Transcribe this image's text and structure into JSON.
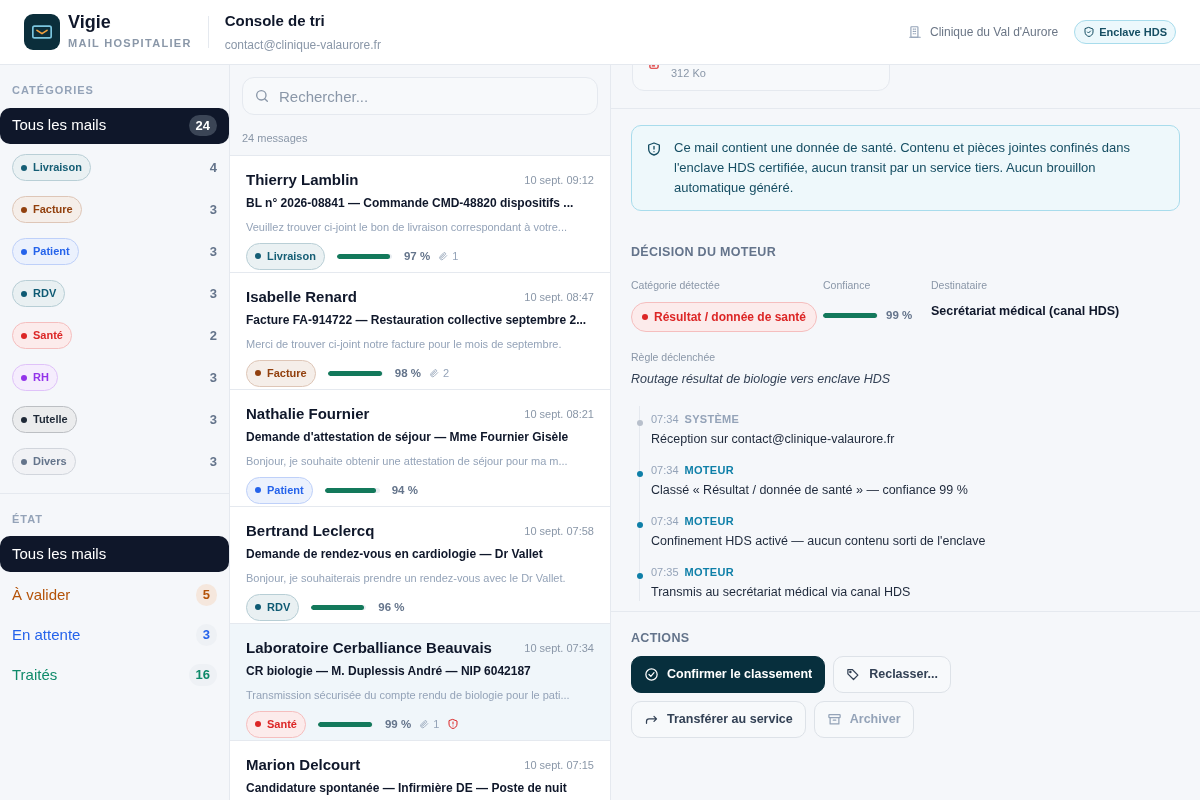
{
  "header": {
    "app_name": "Vigie",
    "app_subtitle": "MAIL HOSPITALIER",
    "title": "Console de tri",
    "account": "contact@clinique-valaurore.fr",
    "organization": "Clinique du Val d'Aurore",
    "badge": "Enclave HDS"
  },
  "sidebar": {
    "categories_heading": "CATÉGORIES",
    "categories": [
      {
        "kind": "all",
        "label": "Tous les mails",
        "count": "24",
        "selected": true
      },
      {
        "kind": "tag",
        "label": "Livraison",
        "count": "4",
        "color": "#155e75",
        "selected": false
      },
      {
        "kind": "tag",
        "label": "Facture",
        "count": "3",
        "color": "#92400e",
        "selected": false
      },
      {
        "kind": "tag",
        "label": "Patient",
        "count": "3",
        "color": "#2563eb",
        "selected": false
      },
      {
        "kind": "tag",
        "label": "RDV",
        "count": "3",
        "color": "#0e5a73",
        "selected": false
      },
      {
        "kind": "tag",
        "label": "Santé",
        "count": "2",
        "color": "#dc2626",
        "selected": false
      },
      {
        "kind": "tag",
        "label": "RH",
        "count": "3",
        "color": "#9333ea",
        "selected": false
      },
      {
        "kind": "tag",
        "label": "Tutelle",
        "count": "3",
        "color": "#1f2937",
        "selected": false
      },
      {
        "kind": "tag",
        "label": "Divers",
        "count": "3",
        "color": "#64748b",
        "selected": false
      }
    ],
    "state_heading": "ÉTAT",
    "states": [
      {
        "label": "Tous les mails",
        "selected": true
      },
      {
        "label": "À valider",
        "count": "5",
        "color": "#b45309",
        "selected": false
      },
      {
        "label": "En attente",
        "count": "3",
        "color": "#2563eb",
        "selected": false
      },
      {
        "label": "Traités",
        "count": "16",
        "color": "#0f8a6a",
        "selected": false
      }
    ]
  },
  "mail_list": {
    "search_placeholder": "Rechercher...",
    "count_label": "24 messages",
    "messages": [
      {
        "sender": "Thierry Lamblin",
        "date": "10 sept. 09:12",
        "subject": "BL n° 2026-08841 — Commande CMD-48820 dispositifs ...",
        "preview": "Veuillez trouver ci-joint le bon de livraison correspondant à votre...",
        "tag": {
          "label": "Livraison",
          "color": "#155e75"
        },
        "level": 0.97,
        "confidence": "97 %",
        "attachments": "1",
        "hds": false,
        "selected": false
      },
      {
        "sender": "Isabelle Renard",
        "date": "10 sept. 08:47",
        "subject": "Facture FA-914722 — Restauration collective septembre 2...",
        "preview": "Merci de trouver ci-joint notre facture pour le mois de septembre.",
        "tag": {
          "label": "Facture",
          "color": "#92400e"
        },
        "level": 0.98,
        "confidence": "98 %",
        "attachments": "2",
        "hds": false,
        "selected": false
      },
      {
        "sender": "Nathalie Fournier",
        "date": "10 sept. 08:21",
        "subject": "Demande d'attestation de séjour — Mme Fournier Gisèle",
        "preview": "Bonjour, je souhaite obtenir une attestation de séjour pour ma m...",
        "tag": {
          "label": "Patient",
          "color": "#2563eb"
        },
        "level": 0.94,
        "confidence": "94 %",
        "hds": false,
        "selected": false
      },
      {
        "sender": "Bertrand Leclercq",
        "date": "10 sept. 07:58",
        "subject": "Demande de rendez-vous en cardiologie — Dr Vallet",
        "preview": "Bonjour, je souhaiterais prendre un rendez-vous avec le Dr Vallet.",
        "tag": {
          "label": "RDV",
          "color": "#0e5a73"
        },
        "level": 0.96,
        "confidence": "96 %",
        "hds": false,
        "selected": false
      },
      {
        "sender": "Laboratoire Cerballiance Beauvais",
        "date": "10 sept. 07:34",
        "subject": "CR biologie — M. Duplessis André — NIP 6042187",
        "preview": "Transmission sécurisée du compte rendu de biologie pour le pati...",
        "tag": {
          "label": "Santé",
          "color": "#dc2626"
        },
        "level": 0.99,
        "confidence": "99 %",
        "attachments": "1",
        "hds": true,
        "selected": true
      },
      {
        "sender": "Marion Delcourt",
        "date": "10 sept. 07:15",
        "subject": "Candidature spontanée — Infirmière DE — Poste de nuit",
        "selected": false
      }
    ]
  },
  "detail": {
    "attachment": {
      "size": "312 Ko"
    },
    "notice": "Ce mail contient une donnée de santé. Contenu et pièces jointes confinés dans l'enclave HDS certifiée, aucun transit par un service tiers. Aucun brouillon automatique généré.",
    "decision": {
      "heading": "DÉCISION DU MOTEUR",
      "category_label": "Catégorie détectée",
      "category": {
        "label": "Résultat / donnée de santé",
        "color": "#dc2626"
      },
      "confidence_label": "Confiance",
      "level": 0.99,
      "confidence": "99 %",
      "recipient_label": "Destinataire",
      "recipient": "Secrétariat médical (canal HDS)",
      "rule_label": "Règle déclenchée",
      "rule": "Routage résultat de biologie vers enclave HDS",
      "timeline": [
        {
          "kind": "system",
          "time": "07:34",
          "actor": "SYSTÈME",
          "text": "Réception sur contact@clinique-valaurore.fr"
        },
        {
          "kind": "engine",
          "time": "07:34",
          "actor": "MOTEUR",
          "text": "Classé « Résultat / donnée de santé » — confiance 99 %"
        },
        {
          "kind": "engine",
          "time": "07:34",
          "actor": "MOTEUR",
          "text": "Confinement HDS activé — aucun contenu sorti de l'enclave"
        },
        {
          "kind": "engine",
          "time": "07:35",
          "actor": "MOTEUR",
          "text": "Transmis au secrétariat médical via canal HDS"
        }
      ]
    },
    "actions": {
      "heading": "ACTIONS",
      "buttons": [
        {
          "kind": "primary",
          "label": "Confirmer le classement",
          "disabled": false
        },
        {
          "kind": "secondary",
          "label": "Reclasser...",
          "disabled": false
        },
        {
          "kind": "secondary",
          "label": "Transférer au service",
          "disabled": false
        },
        {
          "kind": "secondary",
          "label": "Archiver",
          "disabled": true
        }
      ]
    }
  }
}
